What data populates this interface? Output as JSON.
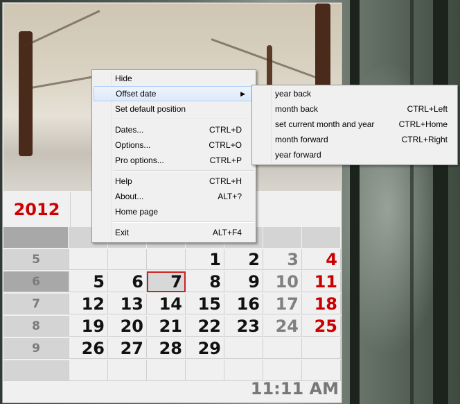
{
  "calendar": {
    "year": "2012",
    "weeks": [
      {
        "week": "5",
        "days": [
          "",
          "",
          "",
          "1",
          "2",
          "3",
          "4"
        ]
      },
      {
        "week": "6",
        "days": [
          "5",
          "6",
          "7",
          "8",
          "9",
          "10",
          "11"
        ]
      },
      {
        "week": "7",
        "days": [
          "12",
          "13",
          "14",
          "15",
          "16",
          "17",
          "18"
        ]
      },
      {
        "week": "8",
        "days": [
          "19",
          "20",
          "21",
          "22",
          "23",
          "24",
          "25"
        ]
      },
      {
        "week": "9",
        "days": [
          "26",
          "27",
          "28",
          "29",
          "",
          "",
          ""
        ]
      },
      {
        "week": "",
        "days": [
          "",
          "",
          "",
          "",
          "",
          "",
          ""
        ]
      }
    ],
    "today": "7",
    "clock": "11:11 AM",
    "colors": {
      "sunday": "#cc0000",
      "saturday": "#808080",
      "year": "#cc0000",
      "today_border": "#cc2222"
    }
  },
  "context_menu": {
    "items": [
      {
        "label": "Hide",
        "shortcut": ""
      },
      {
        "label": "Offset date",
        "shortcut": "",
        "submenu_arrow": "▶"
      },
      {
        "label": "Set default position",
        "shortcut": ""
      },
      {
        "label": "Dates...",
        "shortcut": "CTRL+D"
      },
      {
        "label": "Options...",
        "shortcut": "CTRL+O"
      },
      {
        "label": "Pro options...",
        "shortcut": "CTRL+P"
      },
      {
        "label": "Help",
        "shortcut": "CTRL+H"
      },
      {
        "label": "About...",
        "shortcut": "ALT+?"
      },
      {
        "label": "Home page",
        "shortcut": ""
      },
      {
        "label": "Exit",
        "shortcut": "ALT+F4"
      }
    ]
  },
  "offset_submenu": {
    "items": [
      {
        "label": "year back",
        "shortcut": ""
      },
      {
        "label": "month back",
        "shortcut": "CTRL+Left"
      },
      {
        "label": "set current month and year",
        "shortcut": "CTRL+Home"
      },
      {
        "label": "month forward",
        "shortcut": "CTRL+Right"
      },
      {
        "label": "year forward",
        "shortcut": ""
      }
    ]
  }
}
